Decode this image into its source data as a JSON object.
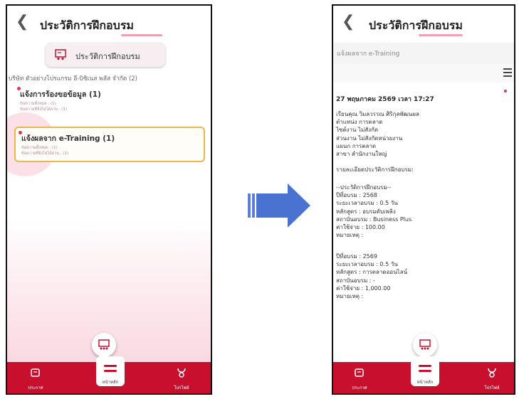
{
  "left": {
    "header": {
      "title": "ประวัติการฝึกอบรม"
    },
    "card": {
      "label": "ประวัติการฝึกอบรม"
    },
    "company": "บริษัท ตัวอย่างโปรแกรม อี-บิซิเนส พลัส  จำกัด  (2)",
    "items": [
      {
        "title": "แจ้งการร้องขอข้อมูล (1)",
        "sub1": "ข้อความทั้งหมด : (1)",
        "sub2": "ข้อความที่ยังไม่ได้อ่าน : (1)"
      },
      {
        "title": "แจ้งผลจาก e-Training (1)",
        "sub1": "ข้อความทั้งหมด : (1)",
        "sub2": "ข้อความที่ยังไม่ได้อ่าน : (1)"
      }
    ]
  },
  "right": {
    "header": {
      "title": "ประวัติการฝึกอบรม"
    },
    "subheader": "แจ้งผลจาก e-Training",
    "date": "27 พฤษภาคม 2569 เวลา 17:27",
    "block1": [
      "เรียนคุณ วิมลวรรณ ศิริกุลพัฒนผล",
      "ตำแหน่ง การตลาด",
      "ไซต์งาน ไม่สังกัด",
      "ส่วนงาน ไม่สังกัดหน่วยงาน",
      "แผนก การตลาด",
      "สาขา สำนักงานใหญ่"
    ],
    "detail_heading": "รายละเอียดประวัติการฝึกอบรม:",
    "record1": [
      "--ประวัติการฝึกอบรม--",
      "ปีที่อบรม : 2568",
      "ระยะเวลาอบรม : 0.5 วัน",
      "หลักสูตร : อบรมดับเพลิง",
      "สถาบันอบรม : Business Plus",
      "ค่าใช้จ่าย : 100.00",
      "หมายเหตุ :"
    ],
    "record2": [
      "ปีที่อบรม : 2569",
      "ระยะเวลาอบรม : 0.5 วัน",
      "หลักสูตร : การตลาดออนไลน์",
      "สถาบันอบรม : -",
      "ค่าใช้จ่าย : 1,000.00",
      "หมายเหตุ :"
    ]
  },
  "nav": {
    "news": "ประกาศ",
    "home": "หน้าหลัก",
    "profile": "โปรไฟล์"
  },
  "colors": {
    "brand": "#c8102e",
    "highlight_border": "#e6b84e",
    "unread_dot": "#e0335a"
  },
  "icons": {
    "back": "chevron-left-icon",
    "card": "training-board-icon",
    "fab": "training-board-icon",
    "nav_news": "news-icon",
    "nav_home": "menu-icon",
    "nav_profile": "profile-icon",
    "transition": "right-arrow-icon"
  }
}
